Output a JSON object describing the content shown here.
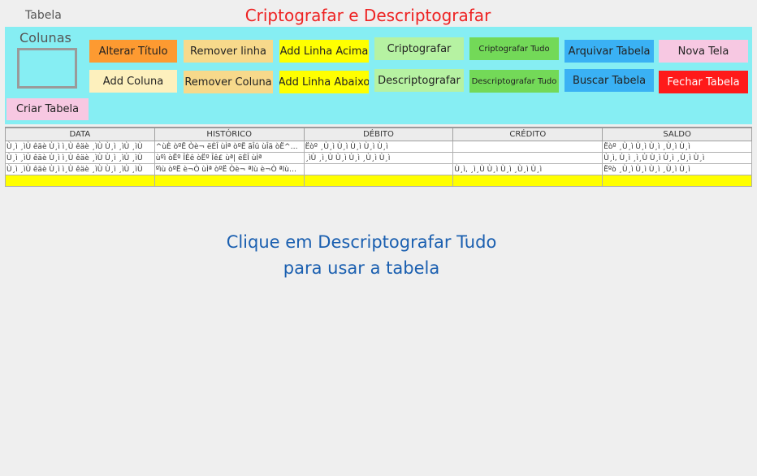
{
  "header": {
    "tab_label": "Tabela",
    "title": "Criptografar e Descriptografar"
  },
  "toolbar": {
    "colunas_label": "Colunas",
    "buttons": {
      "alterar_titulo": "Alterar Título",
      "remover_linha": "Remover linha",
      "add_linha_acima": "Add Linha Acima",
      "criptografar": "Criptografar",
      "criptografar_tudo": "Criptografar Tudo",
      "arquivar_tabela": "Arquivar Tabela",
      "nova_tela": "Nova Tela",
      "add_coluna": "Add Coluna",
      "remover_coluna": "Remover Coluna",
      "add_linha_abaixo": "Add Linha Abaixo",
      "descriptografar": "Descriptografar",
      "descriptografar_tudo": "Descriptografar Tudo",
      "buscar_tabela": "Buscar Tabela",
      "fechar_tabela": "Fechar Tabela",
      "criar_tabela": "Criar Tabela"
    },
    "colors": {
      "toolbar_bg": "#86eef3",
      "orange": "#fd9a31",
      "tan": "#f7d98b",
      "yellow": "#ffff00",
      "light_green": "#b6f2a2",
      "green": "#73d958",
      "blue": "#3ab1f4",
      "pink": "#f7c8e2",
      "cream": "#fdf0bd",
      "red": "#ff1a1a"
    }
  },
  "table": {
    "columns": [
      "DATA",
      "HISTÓRICO",
      "DÉBITO",
      "CRÉDITO",
      "SALDO"
    ],
    "rows": [
      [
        "Ù¸ì ¸ìÙ êäè Ù¸ì ì¸Ù êäè ¸ìÙ Ù¸ì ¸ìÙ ¸ìÙ",
        "^ùÈ òºË Òè¬ ëÈÎ ùÌª  òºË ãÎû ùÎä òË^…",
        "Ëòº  ¸Ù¸ì Ù¸ì Ù¸ì Ù¸ì Ù¸ì",
        "",
        " Ëòº  ¸Ù¸ì Ù¸ì Ù¸ì ¸Ù¸ì Ù¸ì"
      ],
      [
        "Ù¸ì ¸ìÙ êäè Ù¸ì ì¸Ù êäè ¸ìÙ Ù¸ì ¸ìÙ ¸ìÙ",
        "ùºì òËº ÎÈê òËº Îê£ ùª| ëÈÎ ùÌª",
        "¸ìÙ ¸ì¸Ù Ù¸ì Ù¸ì ¸Ù¸ì Ù¸ì",
        "",
        "Ù¸ì, Ù¸ì ¸ì¸Ù Ù¸ì Ù¸ì ¸Ù¸ì Ù¸ì"
      ],
      [
        "Ù¸ì ¸ìÙ êäè Ù¸ì ì¸Ù êäè ¸ìÙ Ù¸ì ¸ìÙ ¸ìÙ",
        "ºìù òºË è¬Ò ùÌª  òºË Òè¬ ªlù è¬Ò ªlù…",
        "",
        "Ù¸ì, ¸ì¸Ù Ù¸ì Ù¸ì ¸Ù¸ì Ù¸ì",
        "Ëºò ¸Ù¸ì Ù¸ì Ù¸ì ¸Ù¸ì Ù¸ì"
      ]
    ]
  },
  "notice": {
    "line1": "Clique em Descriptografar Tudo",
    "line2": "para usar a tabela"
  }
}
